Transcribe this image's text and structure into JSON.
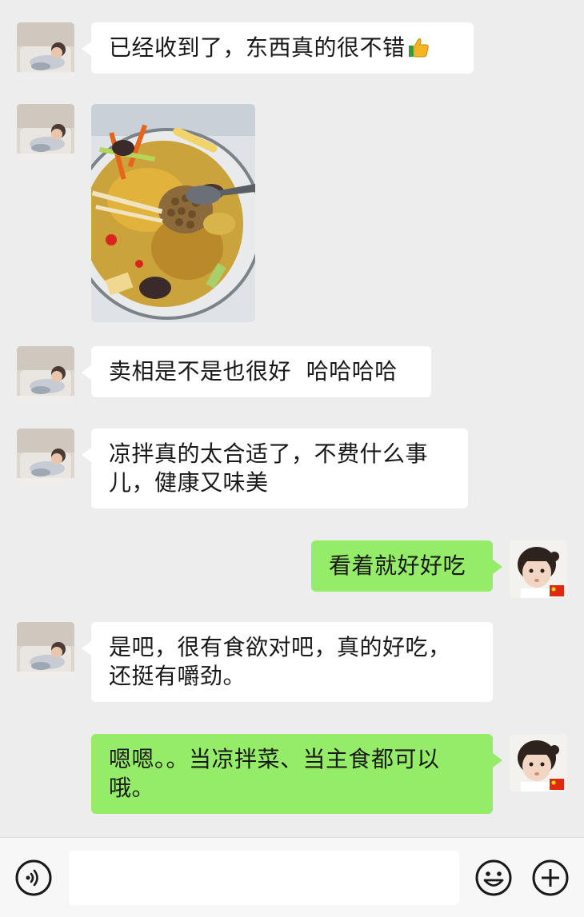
{
  "messages": [
    {
      "side": "left",
      "text": "已经收到了，东西真的很不错",
      "emoji": "thumbs-up-emoji"
    },
    {
      "side": "left",
      "type": "image",
      "image_desc": "food-photo"
    },
    {
      "side": "left",
      "text": "卖相是不是也很好  哈哈哈哈"
    },
    {
      "side": "left",
      "line1": "凉拌真的太合适了，不费什么事",
      "line2": "儿，健康又味美"
    },
    {
      "side": "right",
      "text": "看着就好好吃"
    },
    {
      "side": "left",
      "line1": "是吧，很有食欲对吧，真的好吃，",
      "line2": "还挺有嚼劲。"
    },
    {
      "side": "right",
      "line1": "嗯嗯。。当凉拌菜、当主食都可以",
      "line2": "哦。"
    }
  ],
  "input_bar": {
    "voice_icon": "voice-icon",
    "emoji_icon": "emoji-icon",
    "plus_icon": "plus-icon",
    "text_value": ""
  },
  "colors": {
    "background": "#ededed",
    "sent_bubble": "#95ec69",
    "received_bubble": "#ffffff"
  }
}
